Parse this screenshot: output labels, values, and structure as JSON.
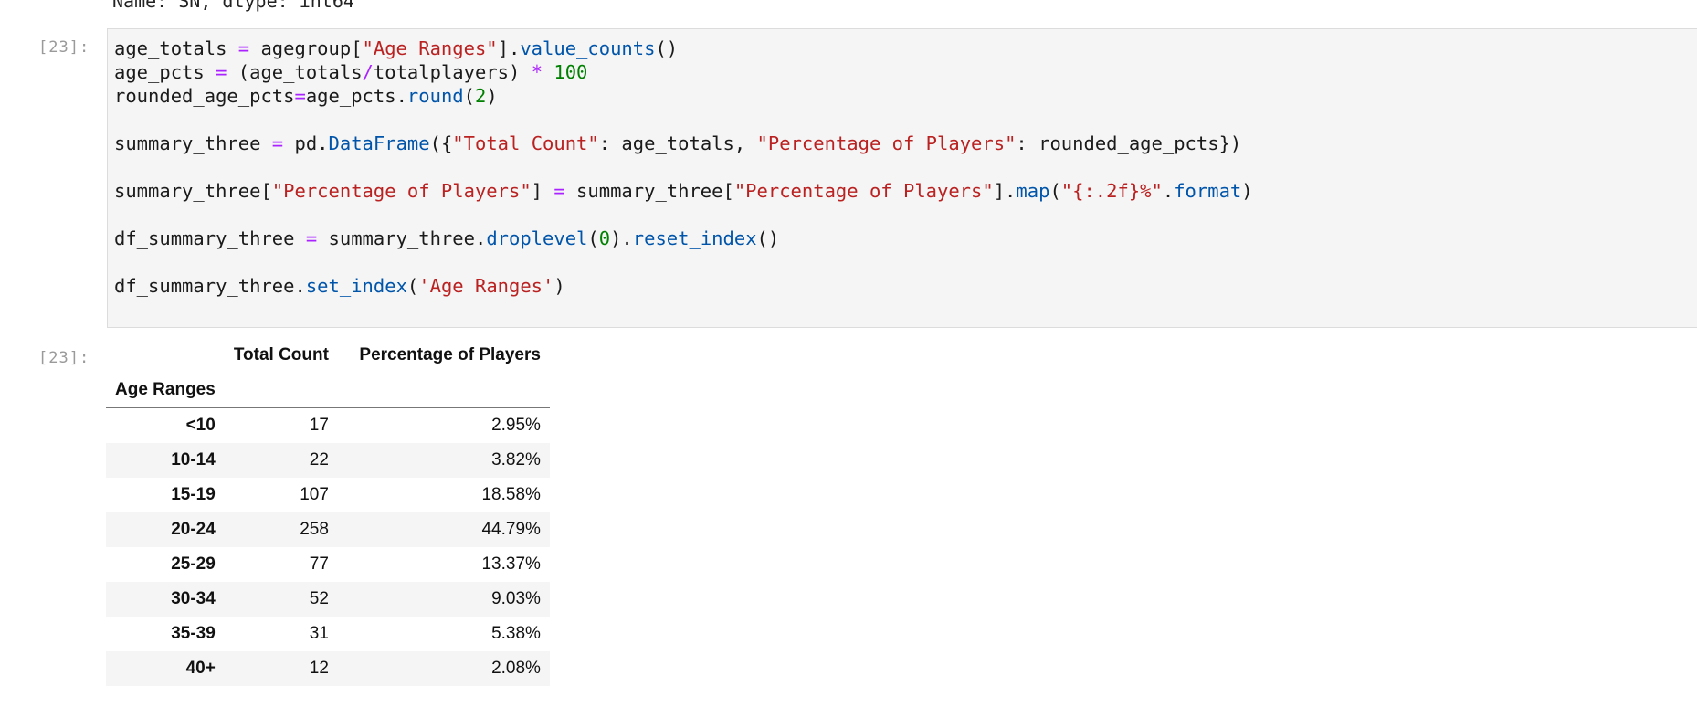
{
  "prev_output": {
    "text": "Name: SN, dtype: int64"
  },
  "input_cell": {
    "prompt": "[23]:",
    "code_lines": [
      [
        [
          "age_totals ",
          ""
        ],
        [
          "=",
          "op"
        ],
        [
          " agegroup[",
          ""
        ],
        [
          "\"Age Ranges\"",
          "str"
        ],
        [
          "].",
          ""
        ],
        [
          "value_counts",
          "fn"
        ],
        [
          "()",
          ""
        ]
      ],
      [
        [
          "age_pcts ",
          ""
        ],
        [
          "=",
          "op"
        ],
        [
          " (age_totals",
          ""
        ],
        [
          "/",
          "op"
        ],
        [
          "totalplayers) ",
          ""
        ],
        [
          "*",
          "op"
        ],
        [
          " ",
          ""
        ],
        [
          "100",
          "num"
        ]
      ],
      [
        [
          "rounded_age_pcts",
          ""
        ],
        [
          "=",
          "op"
        ],
        [
          "age_pcts.",
          ""
        ],
        [
          "round",
          "fn"
        ],
        [
          "(",
          ""
        ],
        [
          "2",
          "num"
        ],
        [
          ")",
          ""
        ]
      ],
      [],
      [
        [
          "summary_three ",
          ""
        ],
        [
          "=",
          "op"
        ],
        [
          " pd.",
          ""
        ],
        [
          "DataFrame",
          "fn"
        ],
        [
          "({",
          ""
        ],
        [
          "\"Total Count\"",
          "str"
        ],
        [
          ": age_totals, ",
          ""
        ],
        [
          "\"Percentage of Players\"",
          "str"
        ],
        [
          ": rounded_age_pcts})",
          ""
        ]
      ],
      [],
      [
        [
          "summary_three[",
          ""
        ],
        [
          "\"Percentage of Players\"",
          "str"
        ],
        [
          "] ",
          ""
        ],
        [
          "=",
          "op"
        ],
        [
          " summary_three[",
          ""
        ],
        [
          "\"Percentage of Players\"",
          "str"
        ],
        [
          "].",
          ""
        ],
        [
          "map",
          "fn"
        ],
        [
          "(",
          ""
        ],
        [
          "\"{:.2f}%\"",
          "str"
        ],
        [
          ".",
          ""
        ],
        [
          "format",
          "fn"
        ],
        [
          ")",
          ""
        ]
      ],
      [],
      [
        [
          "df_summary_three ",
          ""
        ],
        [
          "=",
          "op"
        ],
        [
          " summary_three.",
          ""
        ],
        [
          "droplevel",
          "fn"
        ],
        [
          "(",
          ""
        ],
        [
          "0",
          "num"
        ],
        [
          ").",
          ""
        ],
        [
          "reset_index",
          "fn"
        ],
        [
          "()",
          ""
        ]
      ],
      [],
      [
        [
          "df_summary_three.",
          ""
        ],
        [
          "set_index",
          "fn"
        ],
        [
          "(",
          ""
        ],
        [
          "'Age Ranges'",
          "str"
        ],
        [
          ")",
          ""
        ]
      ]
    ]
  },
  "output_cell": {
    "prompt": "[23]:",
    "table": {
      "columns": [
        "Total Count",
        "Percentage of Players"
      ],
      "index_name": "Age Ranges",
      "rows": [
        {
          "index": "<10",
          "count": "17",
          "pct": "2.95%"
        },
        {
          "index": "10-14",
          "count": "22",
          "pct": "3.82%"
        },
        {
          "index": "15-19",
          "count": "107",
          "pct": "18.58%"
        },
        {
          "index": "20-24",
          "count": "258",
          "pct": "44.79%"
        },
        {
          "index": "25-29",
          "count": "77",
          "pct": "13.37%"
        },
        {
          "index": "30-34",
          "count": "52",
          "pct": "9.03%"
        },
        {
          "index": "35-39",
          "count": "31",
          "pct": "5.38%"
        },
        {
          "index": "40+",
          "count": "12",
          "pct": "2.08%"
        }
      ]
    }
  }
}
